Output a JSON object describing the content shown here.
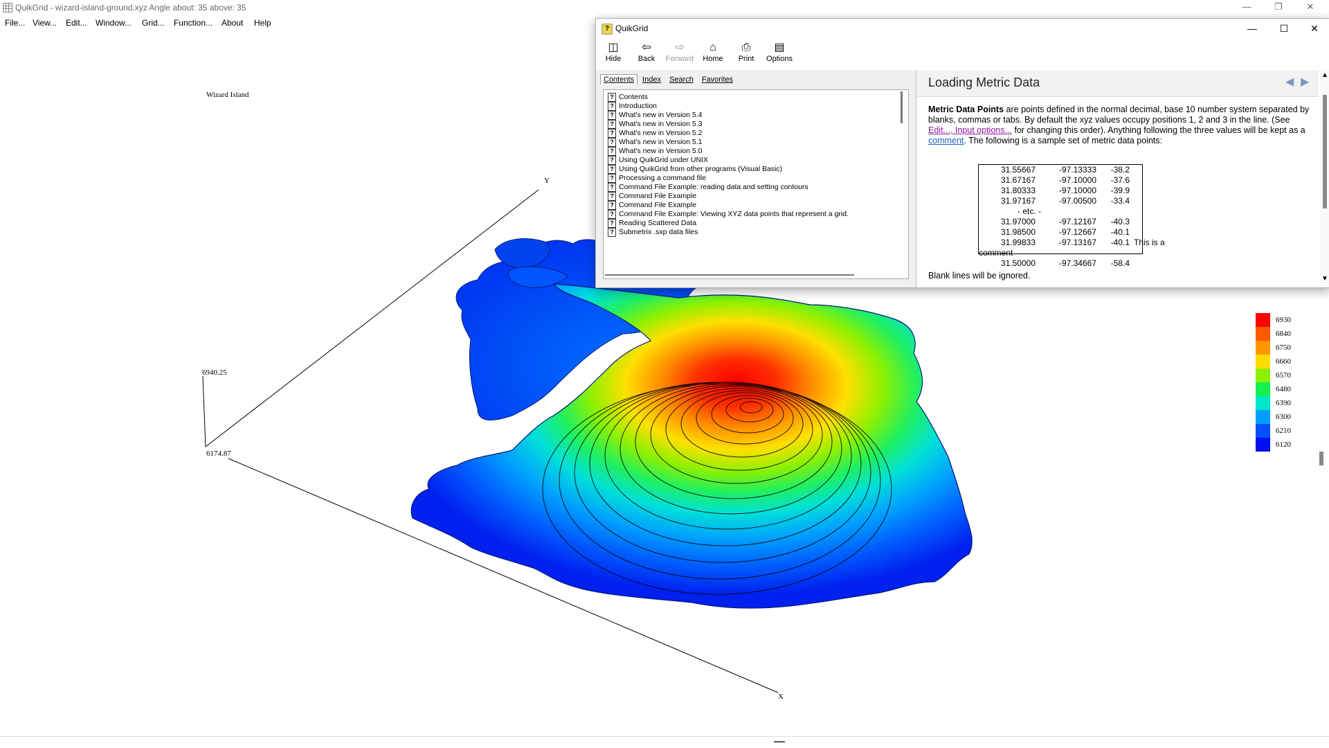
{
  "app": {
    "title": "QuikGrid - wizard-island-ground.xyz Angle about: 35 above: 35",
    "menu": [
      "File...",
      "View...",
      "Edit...",
      "Window...",
      "Grid...",
      "Function...",
      "About",
      "Help"
    ]
  },
  "plot": {
    "title": "Wizard Island",
    "axes": {
      "y_label": "Y",
      "x_label": "X",
      "z_max": "6940.25",
      "z_min": "6174.87"
    },
    "legend": [
      "6930",
      "6840",
      "6750",
      "6660",
      "6570",
      "6480",
      "6390",
      "6300",
      "6210",
      "6120"
    ],
    "legend_colors": [
      "#ff0000",
      "#ff5a00",
      "#ff9600",
      "#ffdc00",
      "#8cf000",
      "#14f050",
      "#00e6c8",
      "#00a0ff",
      "#0050ff",
      "#0010f0"
    ]
  },
  "help": {
    "title": "QuikGrid",
    "toolbar": {
      "hide": "Hide",
      "back": "Back",
      "forward": "Forward",
      "home": "Home",
      "print": "Print",
      "options": "Options"
    },
    "tabs": [
      "Contents",
      "Index",
      "Search",
      "Favorites"
    ],
    "toc": [
      "Contents",
      "Introduction",
      "What's new in Version 5.4",
      "What's new in Version 5.3",
      "What's new in Version 5.2",
      "What's new in Version 5.1",
      "What's new in Version 5.0",
      "Using QuikGrid under UNIX",
      "Using QuikGrid from other programs (Visual Basic)",
      "Processing a command file",
      "Command File Example: reading data and setting contours",
      "Command File Example",
      "Command File Example",
      "Command File Example: Viewing XYZ data points that represent a grid.",
      "Reading Scattered Data",
      "Submetrix .sxp data files"
    ],
    "content": {
      "title": "Loading Metric Data",
      "p_bold": "Metric Data Points",
      "p_text1": " are points defined in the normal decimal, base 10 number system separated by blanks, commas or tabs. By default the xyz values occupy positions 1, 2 and 3 in the line. (See ",
      "p_link1": "Edit..., Input options...",
      "p_text2": " for changing this order). Anything following the three values will be kept as a ",
      "p_link2": "comment",
      "p_text3": ". The following is a sample set of metric data points:",
      "sample_rows": [
        [
          "31.55667",
          "-97.13333",
          "-38.2",
          ""
        ],
        [
          "31.67167",
          "-97.10000",
          "-37.6",
          ""
        ],
        [
          "31.80333",
          "-97.10000",
          "-39.9",
          ""
        ],
        [
          "31.97167",
          "-97.00500",
          "-33.4",
          ""
        ],
        [
          "31.97000",
          "-97.12167",
          "-40.3",
          ""
        ],
        [
          "31.98500",
          "-97.12667",
          "-40.1",
          ""
        ],
        [
          "31.99833",
          "-97.13167",
          "-40.1",
          "This is a"
        ],
        [
          "31.50000",
          "-97.34667",
          "-58.4",
          ""
        ]
      ],
      "etc": "- etc. -",
      "comment_wrap": "comment",
      "blank_note": "Blank lines will be ignored."
    }
  }
}
